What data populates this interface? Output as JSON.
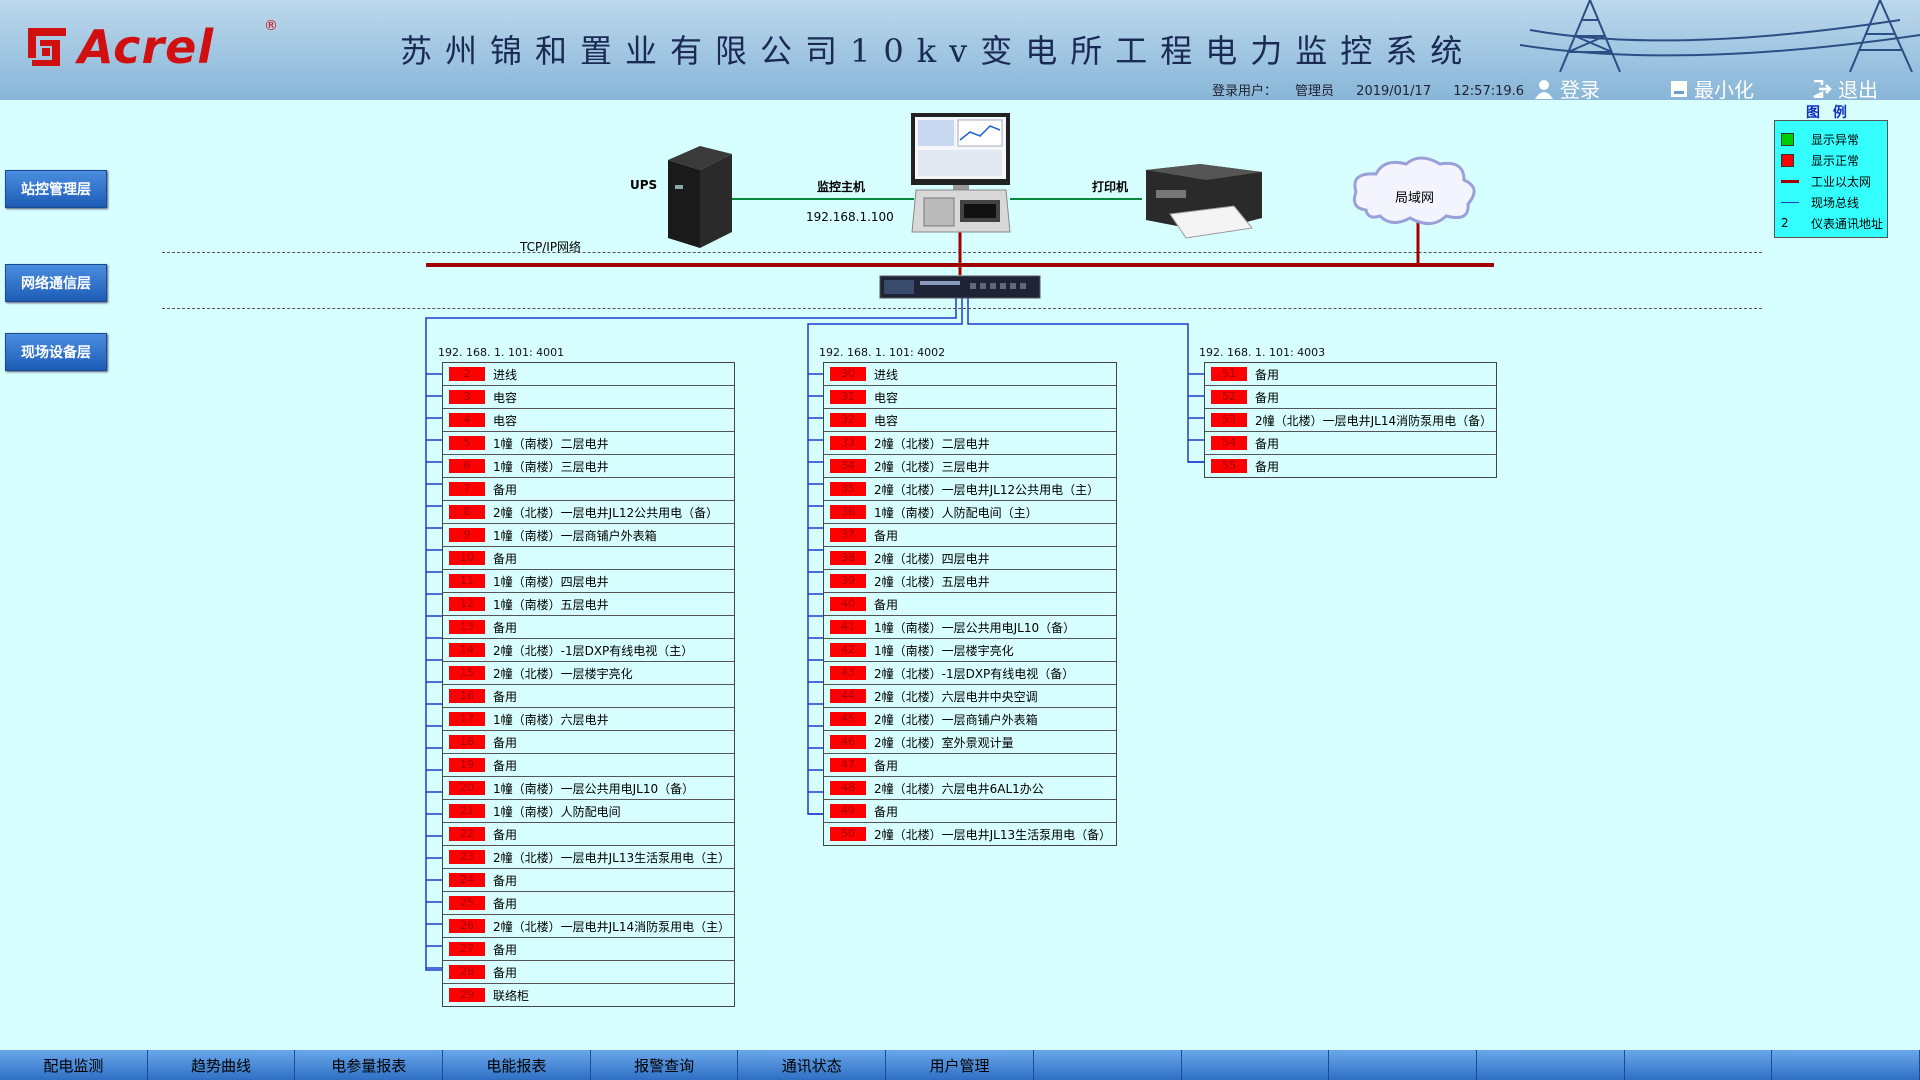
{
  "header": {
    "logo_text": "Acrel",
    "title": "苏州锦和置业有限公司10kv变电所工程电力监控系统",
    "user_label": "登录用户：",
    "user_name": "管理员",
    "date": "2019/01/17",
    "time": "12:57:19.6",
    "login_label": "登录",
    "minimize_label": "最小化",
    "exit_label": "退出"
  },
  "layers": {
    "station": "站控管理层",
    "network": "网络通信层",
    "field": "现场设备层"
  },
  "legend": {
    "title": "图 例",
    "items": [
      {
        "label": "显示异常",
        "symbol": "green-square",
        "color": "#00cc00"
      },
      {
        "label": "显示正常",
        "symbol": "red-square",
        "color": "#ff0000"
      },
      {
        "label": "工业以太网",
        "symbol": "red-line",
        "color": "#a00000"
      },
      {
        "label": "现场总线",
        "symbol": "blue-line",
        "color": "#1a3cd0"
      },
      {
        "label": "仪表通讯地址",
        "symbol": "2"
      }
    ]
  },
  "topology": {
    "ups_label": "UPS",
    "host_label": "监控主机",
    "host_ip": "192.168.1.100",
    "printer_label": "打印机",
    "lan_label": "局域网",
    "tcpip_label": "TCP/IP网络"
  },
  "groups": [
    {
      "ip": "192. 168. 1. 101: 4001",
      "devices": [
        {
          "num": "2",
          "name": "进线"
        },
        {
          "num": "3",
          "name": "电容"
        },
        {
          "num": "4",
          "name": "电容"
        },
        {
          "num": "5",
          "name": "1幢（南楼）二层电井"
        },
        {
          "num": "6",
          "name": "1幢（南楼）三层电井"
        },
        {
          "num": "7",
          "name": "备用"
        },
        {
          "num": "8",
          "name": "2幢（北楼）一层电井JL12公共用电（备）"
        },
        {
          "num": "9",
          "name": "1幢（南楼）一层商铺户外表箱"
        },
        {
          "num": "10",
          "name": "备用"
        },
        {
          "num": "11",
          "name": "1幢（南楼）四层电井"
        },
        {
          "num": "12",
          "name": "1幢（南楼）五层电井"
        },
        {
          "num": "13",
          "name": "备用"
        },
        {
          "num": "14",
          "name": "2幢（北楼）-1层DXP有线电视（主）"
        },
        {
          "num": "15",
          "name": "2幢（北楼）一层楼宇亮化"
        },
        {
          "num": "16",
          "name": "备用"
        },
        {
          "num": "17",
          "name": "1幢（南楼）六层电井"
        },
        {
          "num": "18",
          "name": "备用"
        },
        {
          "num": "19",
          "name": "备用"
        },
        {
          "num": "20",
          "name": "1幢（南楼）一层公共用电JL10（备）"
        },
        {
          "num": "21",
          "name": "1幢（南楼）人防配电间"
        },
        {
          "num": "22",
          "name": "备用"
        },
        {
          "num": "23",
          "name": "2幢（北楼）一层电井JL13生活泵用电（主）"
        },
        {
          "num": "24",
          "name": "备用"
        },
        {
          "num": "25",
          "name": "备用"
        },
        {
          "num": "26",
          "name": "2幢（北楼）一层电井JL14消防泵用电（主）"
        },
        {
          "num": "27",
          "name": "备用"
        },
        {
          "num": "28",
          "name": "备用"
        },
        {
          "num": "29",
          "name": "联络柜"
        }
      ]
    },
    {
      "ip": "192. 168. 1. 101: 4002",
      "devices": [
        {
          "num": "30",
          "name": "进线"
        },
        {
          "num": "31",
          "name": "电容"
        },
        {
          "num": "32",
          "name": "电容"
        },
        {
          "num": "33",
          "name": "2幢（北楼）二层电井"
        },
        {
          "num": "34",
          "name": "2幢（北楼）三层电井"
        },
        {
          "num": "35",
          "name": "2幢（北楼）一层电井JL12公共用电（主）"
        },
        {
          "num": "36",
          "name": "1幢（南楼）人防配电间（主）"
        },
        {
          "num": "37",
          "name": "备用"
        },
        {
          "num": "38",
          "name": "2幢（北楼）四层电井"
        },
        {
          "num": "39",
          "name": "2幢（北楼）五层电井"
        },
        {
          "num": "40",
          "name": "备用"
        },
        {
          "num": "41",
          "name": "1幢（南楼）一层公共用电JL10（备）"
        },
        {
          "num": "42",
          "name": "1幢（南楼）一层楼宇亮化"
        },
        {
          "num": "43",
          "name": "2幢（北楼）-1层DXP有线电视（备）"
        },
        {
          "num": "44",
          "name": "2幢（北楼）六层电井中央空调"
        },
        {
          "num": "45",
          "name": "2幢（北楼）一层商铺户外表箱"
        },
        {
          "num": "46",
          "name": "2幢（北楼）室外景观计量"
        },
        {
          "num": "47",
          "name": "备用"
        },
        {
          "num": "48",
          "name": "2幢（北楼）六层电井6AL1办公"
        },
        {
          "num": "49",
          "name": "备用"
        },
        {
          "num": "50",
          "name": "2幢（北楼）一层电井JL13生活泵用电（备）"
        }
      ]
    },
    {
      "ip": "192. 168. 1. 101: 4003",
      "devices": [
        {
          "num": "51",
          "name": "备用"
        },
        {
          "num": "52",
          "name": "备用"
        },
        {
          "num": "53",
          "name": "2幢（北楼）一层电井JL14消防泵用电（备）"
        },
        {
          "num": "54",
          "name": "备用"
        },
        {
          "num": "55",
          "name": "备用"
        }
      ]
    }
  ],
  "nav": {
    "tabs": [
      "配电监测",
      "趋势曲线",
      "电参量报表",
      "电能报表",
      "报警查询",
      "通讯状态",
      "用户管理",
      "",
      "",
      "",
      "",
      "",
      ""
    ]
  }
}
